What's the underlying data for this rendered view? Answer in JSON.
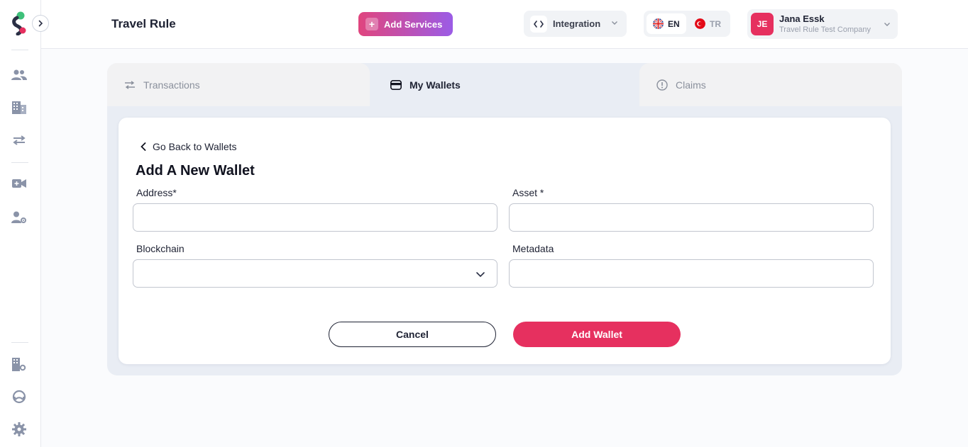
{
  "header": {
    "title": "Travel Rule",
    "add_services_label": "Add Services",
    "integration_label": "Integration",
    "lang_en": "EN",
    "lang_tr": "TR",
    "user": {
      "initials": "JE",
      "name": "Jana Essk",
      "company": "Travel Rule Test Company"
    }
  },
  "tabs": [
    {
      "label": "Transactions",
      "icon": "transfer-icon",
      "active": false
    },
    {
      "label": "My Wallets",
      "icon": "wallet-icon",
      "active": true
    },
    {
      "label": "Claims",
      "icon": "alert-circle-icon",
      "active": false
    }
  ],
  "form": {
    "back_label": "Go Back to Wallets",
    "title": "Add A New Wallet",
    "address_label": "Address*",
    "address_value": "",
    "asset_label": "Asset *",
    "asset_value": "",
    "blockchain_label": "Blockchain",
    "blockchain_value": "",
    "metadata_label": "Metadata",
    "metadata_value": "",
    "cancel_label": "Cancel",
    "submit_label": "Add Wallet"
  },
  "sidebar": {
    "icons": [
      "users-icon",
      "building-icon",
      "transfer-icon",
      "video-add-icon",
      "user-settings-icon",
      "building-settings-icon",
      "support-icon",
      "gear-icon"
    ]
  },
  "colors": {
    "accent": "#e6305f",
    "gradient_start": "#e0457e",
    "gradient_end": "#9b5ce6"
  }
}
